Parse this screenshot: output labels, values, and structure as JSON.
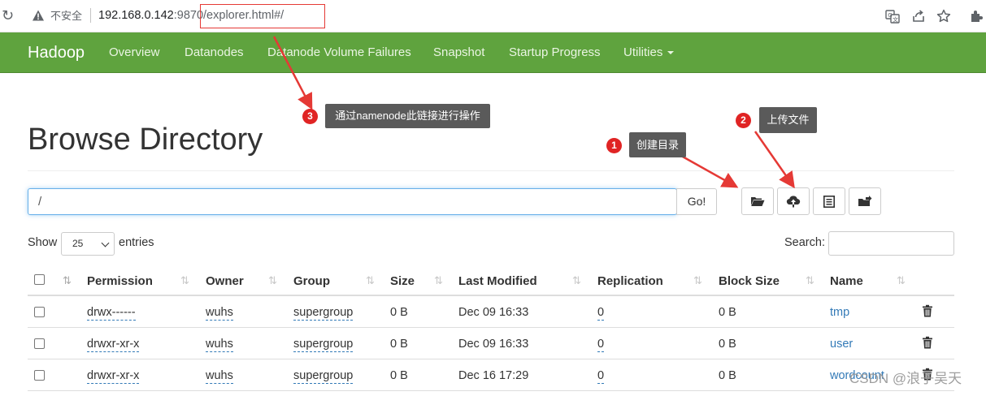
{
  "browser": {
    "insecure_label": "不安全",
    "url_host": "192.168.0.142",
    "url_port": ":9870",
    "url_path": "/explorer.html#/"
  },
  "navbar": {
    "brand": "Hadoop",
    "links": [
      "Overview",
      "Datanodes",
      "Datanode Volume Failures",
      "Snapshot",
      "Startup Progress",
      "Utilities"
    ]
  },
  "page": {
    "title": "Browse Directory",
    "path_value": "/",
    "go_label": "Go!",
    "show_label": "Show",
    "entries_value": "25",
    "entries_label": "entries",
    "search_label": "Search:"
  },
  "table": {
    "headers": [
      "Permission",
      "Owner",
      "Group",
      "Size",
      "Last Modified",
      "Replication",
      "Block Size",
      "Name"
    ],
    "rows": [
      {
        "permission": "drwx------",
        "owner": "wuhs",
        "group": "supergroup",
        "size": "0 B",
        "modified": "Dec 09 16:33",
        "replication": "0",
        "block_size": "0 B",
        "name": "tmp"
      },
      {
        "permission": "drwxr-xr-x",
        "owner": "wuhs",
        "group": "supergroup",
        "size": "0 B",
        "modified": "Dec 09 16:33",
        "replication": "0",
        "block_size": "0 B",
        "name": "user"
      },
      {
        "permission": "drwxr-xr-x",
        "owner": "wuhs",
        "group": "supergroup",
        "size": "0 B",
        "modified": "Dec 16 17:29",
        "replication": "0",
        "block_size": "0 B",
        "name": "wordcount"
      }
    ]
  },
  "callouts": [
    {
      "number": "1",
      "text": "创建目录"
    },
    {
      "number": "2",
      "text": "上传文件"
    },
    {
      "number": "3",
      "text": "通过namenode此链接进行操作"
    }
  ],
  "watermark": "CSDN @浪子吴天",
  "colors": {
    "navbar": "#5fa33e",
    "link": "#337ab7",
    "callout_badge": "#e02424",
    "callout_bg": "#5a5a5a",
    "annotation_red": "#e53935"
  }
}
